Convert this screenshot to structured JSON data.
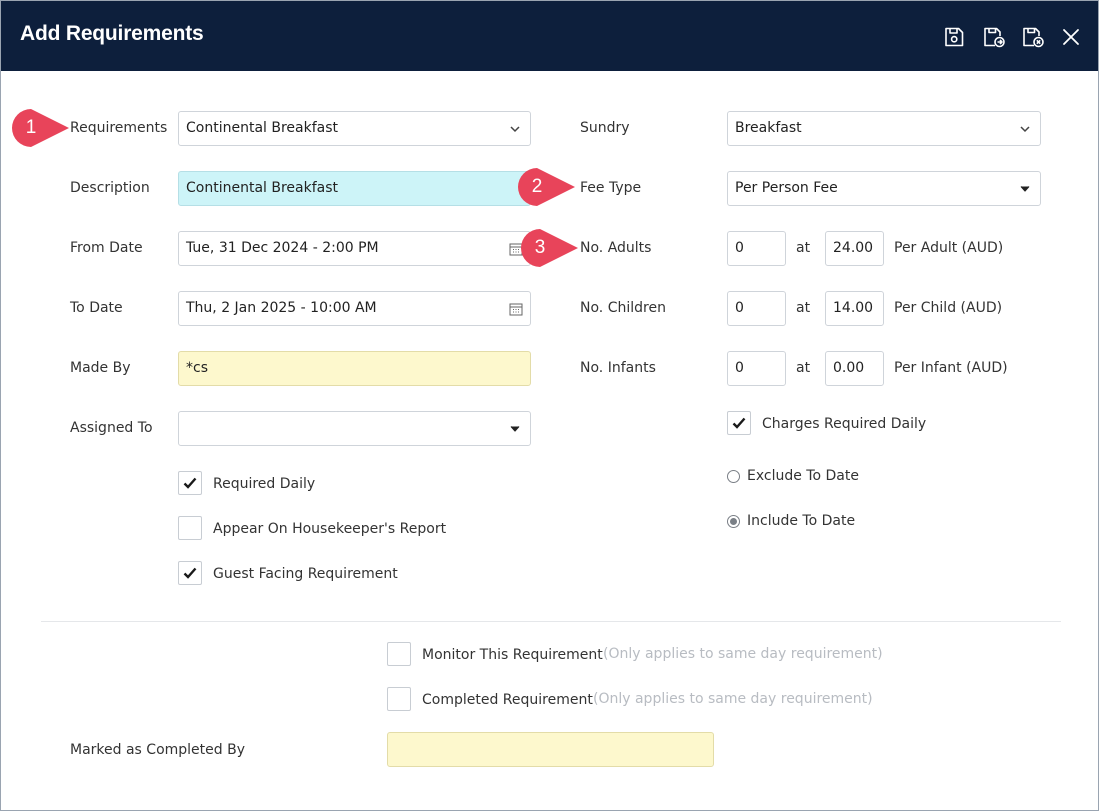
{
  "window": {
    "title": "Add Requirements"
  },
  "toolbar": {
    "icons": [
      "save-icon",
      "save-and-new-icon",
      "save-and-close-icon",
      "close-icon"
    ]
  },
  "form": {
    "requirements": {
      "label": "Requirements",
      "value": "Continental Breakfast"
    },
    "description": {
      "label": "Description",
      "value": "Continental Breakfast"
    },
    "from_date": {
      "label": "From Date",
      "value": "Tue, 31 Dec 2024 - 2:00 PM"
    },
    "to_date": {
      "label": "To Date",
      "value": "Thu, 2 Jan 2025 - 10:00 AM"
    },
    "made_by": {
      "label": "Made By",
      "value": "*cs"
    },
    "assigned_to": {
      "label": "Assigned To",
      "value": ""
    },
    "required_daily": {
      "label": "Required Daily",
      "checked": true
    },
    "housekeeper_report": {
      "label": "Appear On Housekeeper's Report",
      "checked": false
    },
    "guest_facing": {
      "label": "Guest Facing Requirement",
      "checked": true
    },
    "sundry": {
      "label": "Sundry",
      "value": "Breakfast"
    },
    "fee_type": {
      "label": "Fee Type",
      "value": "Per Person Fee"
    },
    "adults": {
      "label": "No. Adults",
      "count": "0",
      "at": "at",
      "price": "24.00",
      "unit": "Per Adult (AUD)"
    },
    "children": {
      "label": "No. Children",
      "count": "0",
      "at": "at",
      "price": "14.00",
      "unit": "Per Child (AUD)"
    },
    "infants": {
      "label": "No. Infants",
      "count": "0",
      "at": "at",
      "price": "0.00",
      "unit": "Per Infant (AUD)"
    },
    "charges_daily": {
      "label": "Charges Required Daily",
      "checked": true
    },
    "exclude_to_date": {
      "label": "Exclude To Date",
      "selected": false
    },
    "include_to_date": {
      "label": "Include To Date",
      "selected": true
    },
    "monitor": {
      "label": "Monitor This Requirement",
      "hint": "(Only applies to same day requirement)",
      "checked": false
    },
    "completed": {
      "label": "Completed Requirement",
      "hint": "(Only applies to same day requirement)",
      "checked": false
    },
    "marked_completed_by": {
      "label": "Marked as Completed By",
      "value": ""
    }
  },
  "annotations": [
    "1",
    "2",
    "3"
  ],
  "colors": {
    "titlebar": "#0d1f3c",
    "badge": "#e8445a",
    "description_bg": "#cdf4f8",
    "made_by_bg": "#fdf8cd"
  }
}
